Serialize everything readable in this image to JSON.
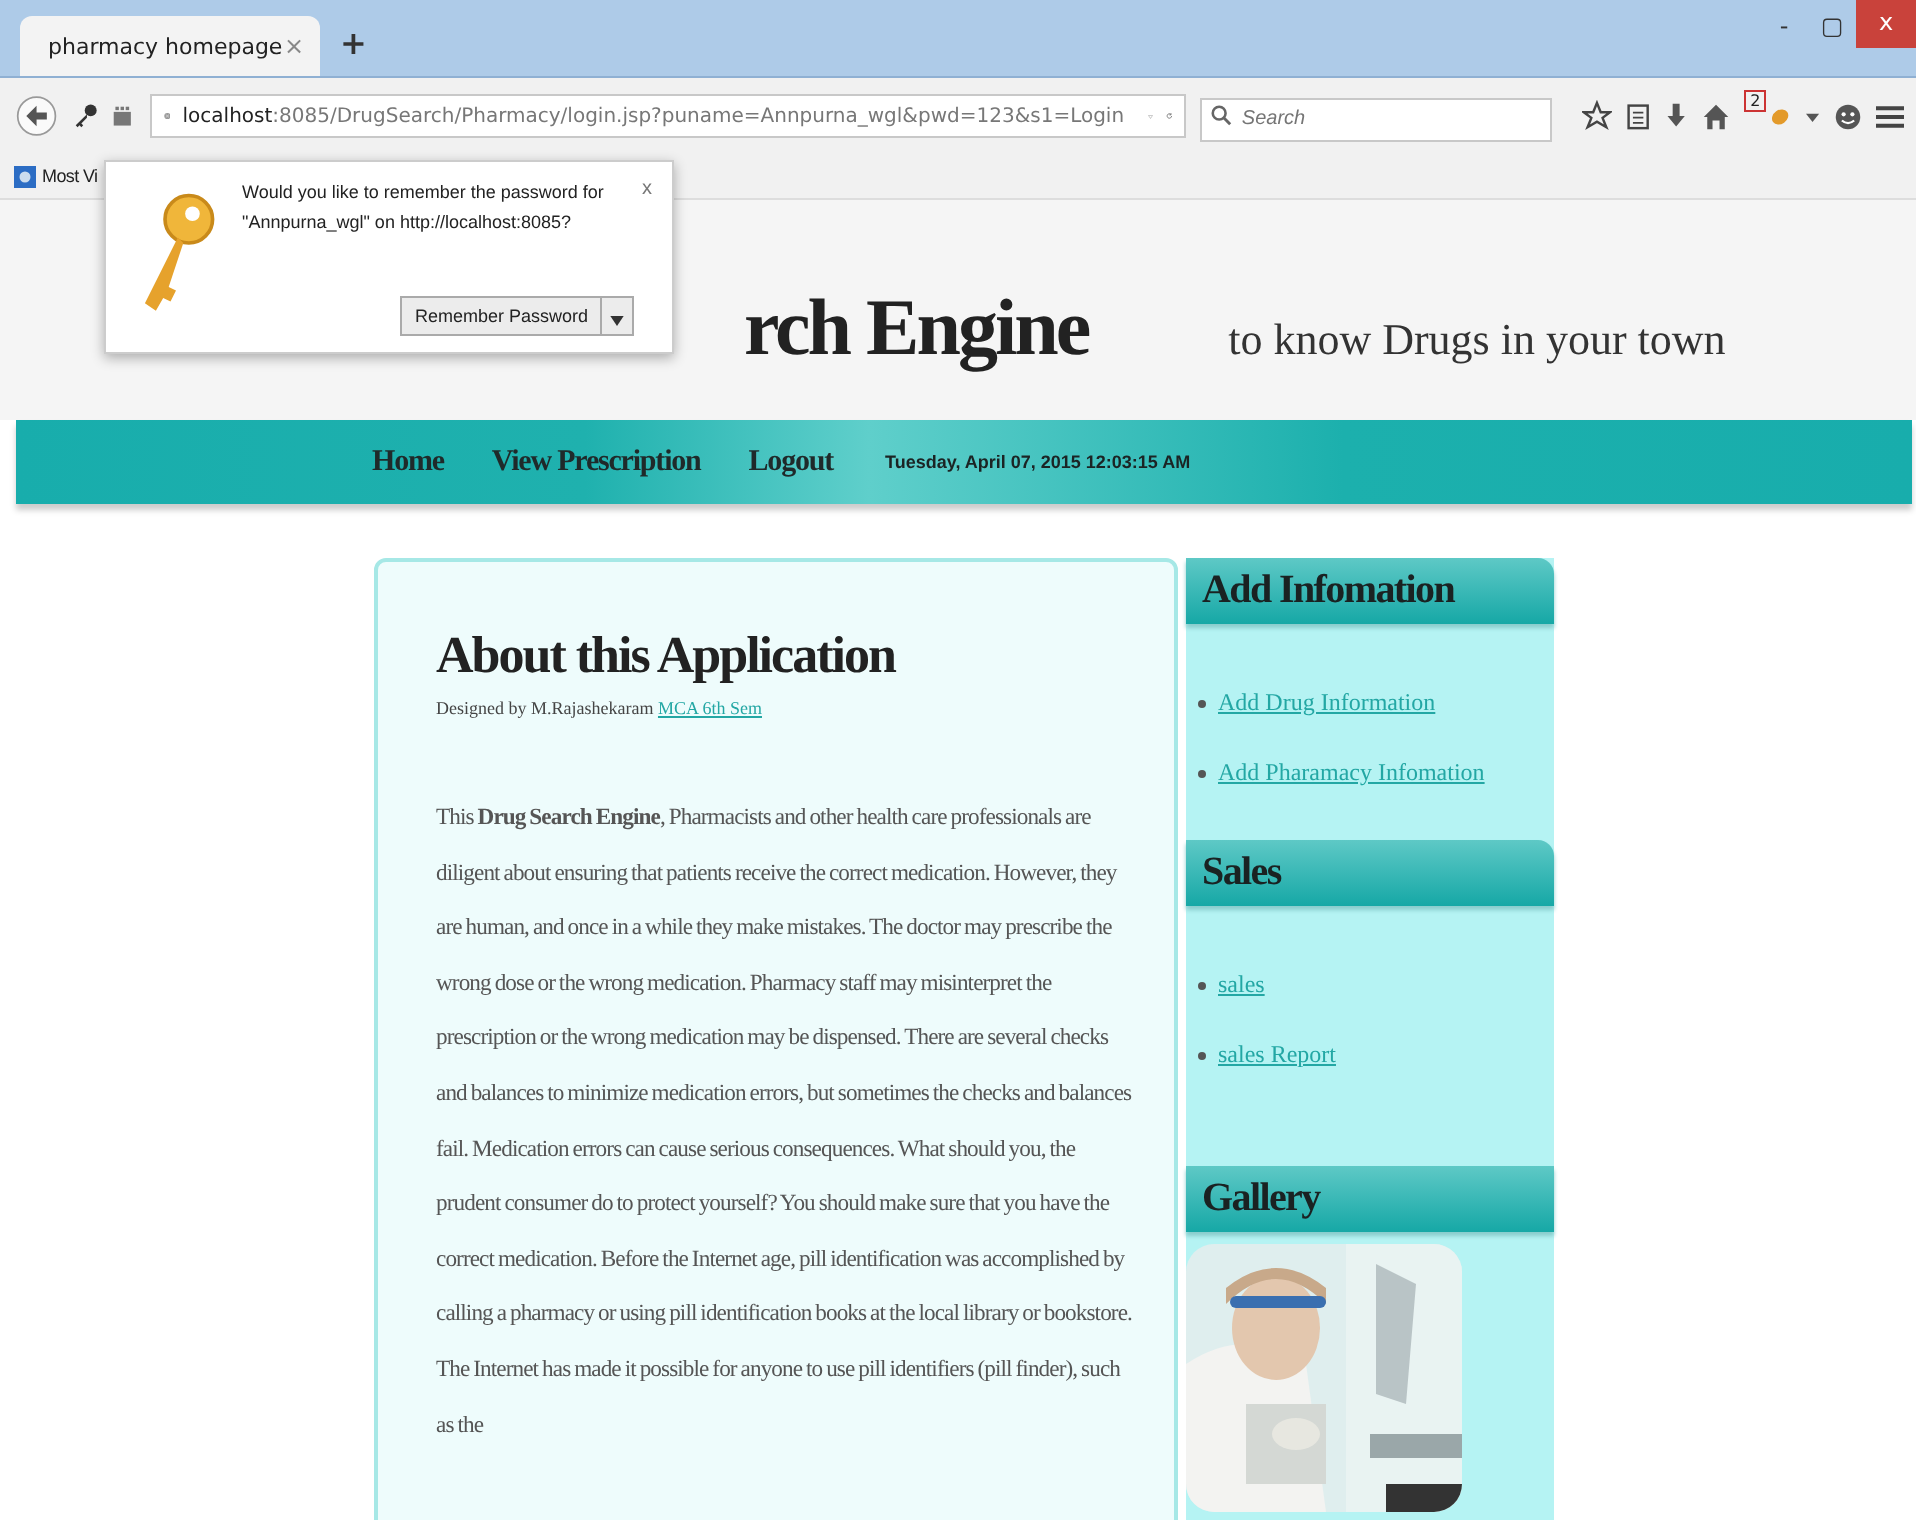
{
  "browser": {
    "tab": {
      "title": "pharmacy homepage",
      "close": "×"
    },
    "new_tab": "+",
    "window_controls": {
      "minimize": "-",
      "restore": "▢",
      "close": "x"
    },
    "address": {
      "host": "localhost",
      "rest": ":8085/DrugSearch/Pharmacy/login.jsp?puname=Annpurna_wgl&pwd=123&s1=Login"
    },
    "search": {
      "placeholder": "Search"
    },
    "badge": "2",
    "bookmarks": [
      {
        "label": "Most Vi"
      }
    ]
  },
  "password_prompt": {
    "message": "Would you like to remember the password for \"Annpurna_wgl\" on http://localhost:8085?",
    "close": "x",
    "button": "Remember Password"
  },
  "header": {
    "title": "rch Engine",
    "tagline": "to know Drugs in your town"
  },
  "nav": {
    "items": [
      {
        "label": "Home"
      },
      {
        "label": "View Prescription"
      },
      {
        "label": "Logout"
      }
    ],
    "datetime": "Tuesday, April 07, 2015 12:03:15 AM"
  },
  "main": {
    "heading": "About this Application",
    "credit": "Designed by M.Rajashekaram",
    "credit_link": "MCA 6th Sem",
    "paragraph": "This **Drug Search Engine**, Pharmacists and other health care professionals are diligent about ensuring that patients receive the correct medication. However, they are human, and once in a while they make mistakes. The doctor may prescribe the wrong dose or the wrong medication. Pharmacy staff may misinterpret the prescription or the wrong medication may be dispensed. There are several checks and balances to minimize medication errors, but sometimes the checks and balances fail. Medication errors can cause serious consequences. What should you, the prudent consumer do to protect yourself? You should make sure that you have the correct medication. Before the Internet age, pill identification was accomplished by calling a pharmacy or using pill identification books at the local library or bookstore. The Internet has made it possible for anyone to use pill identifiers (pill finder), such as the"
  },
  "sidebar": [
    {
      "kind": "links",
      "title": "Add Infomation",
      "links": [
        "Add Drug Information",
        "Add Pharamacy Infomation"
      ]
    },
    {
      "kind": "links",
      "title": "Sales",
      "links": [
        "sales",
        "sales Report"
      ]
    },
    {
      "kind": "gallery",
      "title": "Gallery"
    }
  ]
}
